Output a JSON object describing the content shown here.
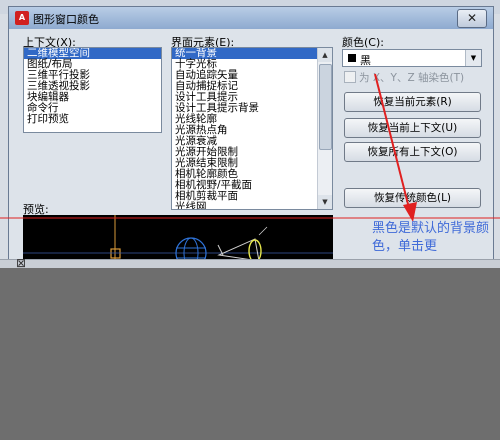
{
  "dialog": {
    "title": "图形窗口颜色",
    "app_icon_text": "A",
    "close_symbol": "✕"
  },
  "context": {
    "label": "上下文(X):",
    "items": [
      "二维模型空间",
      "图纸/布局",
      "三维平行投影",
      "三维透视投影",
      "块编辑器",
      "命令行",
      "打印预览"
    ],
    "selected_index": 0
  },
  "elements": {
    "label": "界面元素(E):",
    "items": [
      "统一背景",
      "十字光标",
      "自动追踪矢量",
      "自动捕捉标记",
      "设计工具提示",
      "设计工具提示背景",
      "光线轮廓",
      "光源热点角",
      "光源衰减",
      "光源开始限制",
      "光源结束限制",
      "相机轮廓颜色",
      "相机视野/平截面",
      "相机剪裁平面",
      "光线网"
    ],
    "selected_index": 0
  },
  "color": {
    "label": "颜色(C):",
    "value": "黑",
    "swatch": "#000000",
    "tint_checkbox_label": "为 X、Y、Z 轴染色(T)",
    "tint_checked": false
  },
  "buttons": {
    "restore_element": "恢复当前元素(R)",
    "restore_context": "恢复当前上下文(U)",
    "restore_all": "恢复所有上下文(O)",
    "restore_classic": "恢复传统颜色(L)"
  },
  "preview": {
    "label": "预览:"
  },
  "annotation": {
    "text": "黑色是默认的背景颜色，单击更",
    "color": "#3f6ad8"
  },
  "colors": {
    "accent_arrow": "#e02020",
    "selection": "#3169c6"
  }
}
